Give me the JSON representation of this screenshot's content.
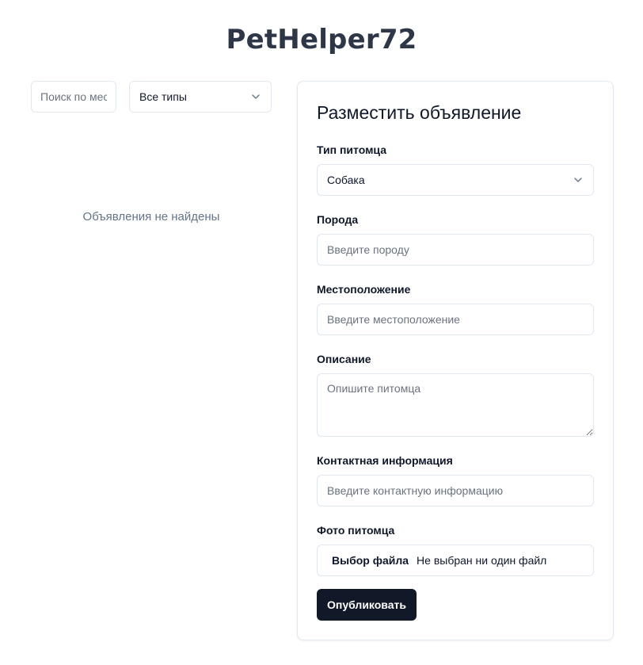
{
  "app": {
    "title": "PetHelper72"
  },
  "filters": {
    "search_placeholder": "Поиск по местоположению",
    "type_select_value": "Все типы"
  },
  "listings": {
    "empty_text": "Объявления не найдены"
  },
  "form": {
    "title": "Разместить объявление",
    "pet_type": {
      "label": "Тип питомца",
      "value": "Собака"
    },
    "breed": {
      "label": "Порода",
      "placeholder": "Введите породу"
    },
    "location": {
      "label": "Местоположение",
      "placeholder": "Введите местоположение"
    },
    "description": {
      "label": "Описание",
      "placeholder": "Опишите питомца"
    },
    "contact": {
      "label": "Контактная информация",
      "placeholder": "Введите контактную информацию"
    },
    "photo": {
      "label": "Фото питомца",
      "button": "Выбор файла",
      "status": "Не выбран ни один файл"
    },
    "submit_label": "Опубликовать"
  },
  "icons": {
    "select_chevron": "chevron-down-icon"
  },
  "colors": {
    "primary_button": "#111827",
    "title": "#2d3748",
    "muted_text": "#64748b",
    "border": "#e2e8f0"
  }
}
